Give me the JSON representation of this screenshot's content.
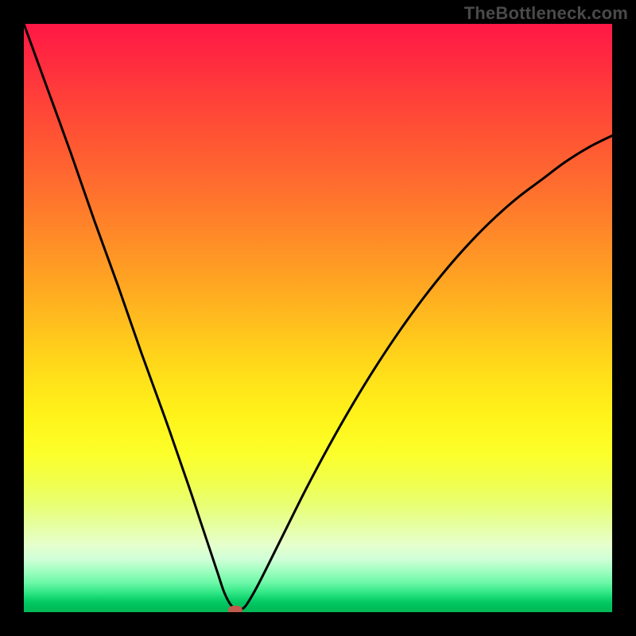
{
  "watermark": "TheBottleneck.com",
  "colors": {
    "frame": "#000000",
    "marker": "#c15a4f",
    "curve": "#000000"
  },
  "chart_data": {
    "type": "line",
    "title": "",
    "xlabel": "",
    "ylabel": "",
    "xlim": [
      0,
      100
    ],
    "ylim": [
      0,
      100
    ],
    "x": [
      0,
      4,
      8,
      12,
      16,
      20,
      24,
      28,
      30,
      32,
      33,
      34,
      35,
      36,
      37,
      38,
      40,
      44,
      48,
      52,
      56,
      60,
      64,
      68,
      72,
      76,
      80,
      84,
      88,
      92,
      96,
      100
    ],
    "values": [
      100,
      89,
      78,
      66.5,
      55.5,
      44,
      33,
      21.5,
      15.5,
      9.5,
      6.5,
      3.5,
      1.5,
      0.5,
      0.5,
      1.5,
      5,
      13,
      21,
      28.5,
      35.5,
      42,
      48,
      53.5,
      58.5,
      63,
      67,
      70.5,
      73.5,
      76.5,
      79,
      81
    ],
    "optimum_marker": {
      "x": 36,
      "y": 0
    },
    "annotations": []
  }
}
